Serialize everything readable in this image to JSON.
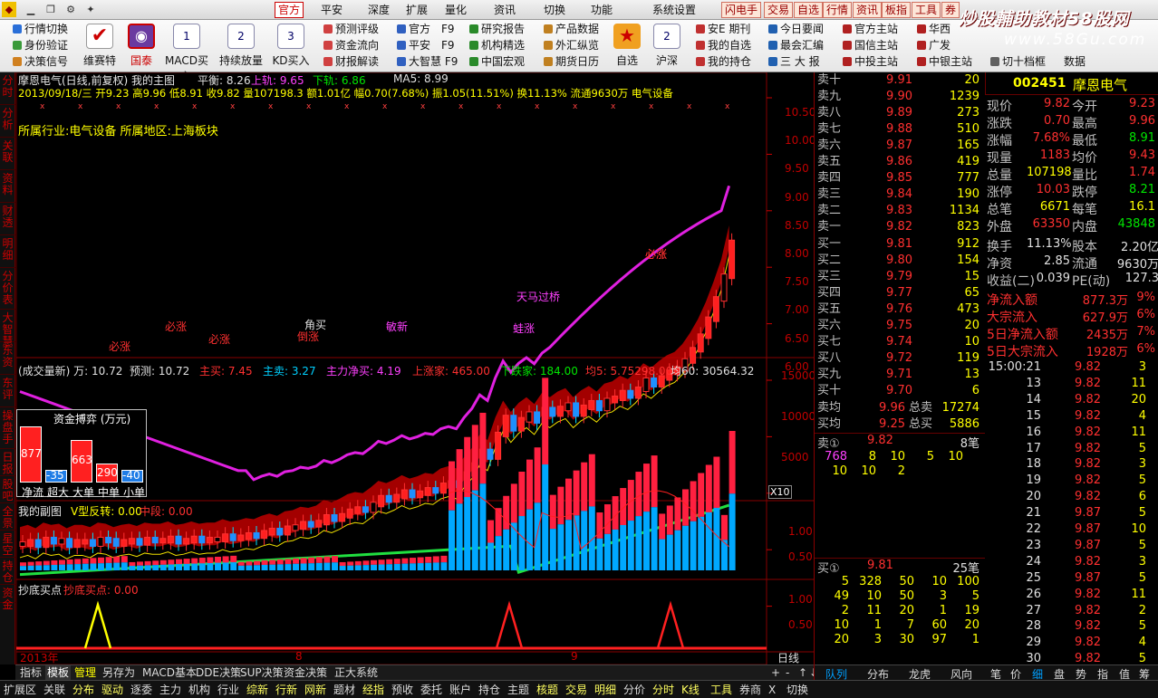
{
  "menubar": {
    "left_menus": [
      "官方",
      "平安",
      "深度",
      "扩展",
      "量化",
      "资讯",
      "切换",
      "功能",
      "系统设置"
    ],
    "quick": [
      "闪电手",
      "交易",
      "自选",
      "行情",
      "资讯",
      "板指",
      "工具",
      "券"
    ],
    "sys_icons": [
      "app-icon",
      "minimize-icon",
      "maximize-icon",
      "close-icon"
    ]
  },
  "brand": {
    "line1": "炒股輔助教材58股网",
    "line2": "www.58Gu.com"
  },
  "toolbar": {
    "col1": [
      "行情切换",
      "身份验证",
      "决策信号"
    ],
    "big": [
      "维赛特",
      "国泰",
      "MACD买入",
      "持续放量",
      "KD买入"
    ],
    "col2": [
      "预测评级",
      "资金流向",
      "财报解读"
    ],
    "col3": [
      "官方　F9",
      "平安　F9",
      "大智慧 F9"
    ],
    "col4": [
      "研究报告",
      "机构精选",
      "中国宏观"
    ],
    "col5": [
      "产品数据",
      "外汇纵览",
      "期货日历"
    ],
    "big2": [
      "自选",
      "沪深"
    ],
    "col6": [
      "安E 期刊",
      "我的自选",
      "我的持仓"
    ],
    "col7": [
      "今日要闻",
      "最会汇编",
      "三 大 报"
    ],
    "col8": [
      "官方主站",
      "国信主站",
      "中投主站"
    ],
    "col9": [
      "华西",
      "广发",
      "中银主站"
    ],
    "col10": [
      "切十档框",
      "数据"
    ]
  },
  "chart": {
    "title": "摩恩电气(日线,前复权) 我的主图",
    "pingheng": "平衡: 8.26",
    "shanggui": "上轨: 9.65",
    "xiagui": "下轨: 6.86",
    "ma5": "MA5: 8.99",
    "ohlc_line": "2013/09/18/三 开9.23 高9.96 低8.91 收9.82 量107198.3 额1.01亿 幅0.70(7.68%) 振1.05(11.51%) 换11.13% 流通9630万 电气设备",
    "industry": "所属行业:电气设备 所属地区:上海板块",
    "annotations": [
      "必涨",
      "必涨",
      "必涨",
      "倒涨",
      "角买",
      "敏新",
      "必涨",
      "天马过桥",
      "蛙涨",
      "必涨"
    ],
    "y_labels": [
      "10.50",
      "10.00",
      "9.50",
      "9.00",
      "8.50",
      "8.00",
      "7.50",
      "7.00",
      "6.50",
      "6.00"
    ],
    "vol_header": [
      "(成交量新) 万: 10.72",
      "预测: 10.72",
      "主买: 7.45",
      "主卖: 3.27",
      "主力净买: 4.19",
      "上涨家: 465.00",
      "下跌家: 184.00",
      "均5: 5.75298.00",
      "均60: 30564.32"
    ],
    "vol_y": [
      "15000",
      "10000",
      "5000"
    ],
    "fund_box": {
      "title": "资金搏弈 (万元)",
      "values": [
        "877",
        "-35",
        "663",
        "290",
        "-40"
      ],
      "labels": [
        "净流",
        "超大",
        "大单",
        "中单",
        "小单"
      ]
    },
    "x10": "X10",
    "sub1_header": [
      "我的副图",
      "V型反转: 0.00",
      "中段: 0.00"
    ],
    "sub1_y": [
      "1.00",
      "0.50"
    ],
    "sub2_header": [
      "抄底买点",
      "抄底买点: 0.00"
    ],
    "sub2_y": [
      "1.00",
      "0.50"
    ],
    "x_axis": [
      "2013年",
      "8",
      "9"
    ],
    "period": "日线"
  },
  "left_tabs": [
    "分时",
    "分析",
    "关联",
    "资料",
    "财透",
    "明细",
    "分价表",
    "大智慧",
    "东资",
    "东评",
    "操盘手",
    "日报",
    "股吧",
    "全景",
    "星空",
    "持仓",
    "资金"
  ],
  "tabs": [
    "指标",
    "模板",
    "管理",
    "另存为",
    "MACD基本",
    "DDE决策",
    "SUP决策",
    "资金决策",
    "正大系统"
  ],
  "quote": {
    "code": "002451",
    "name": "摩恩电气",
    "asks": [
      [
        "卖十",
        "9.91",
        "20"
      ],
      [
        "卖九",
        "9.90",
        "1239"
      ],
      [
        "卖八",
        "9.89",
        "273"
      ],
      [
        "卖七",
        "9.88",
        "510"
      ],
      [
        "卖六",
        "9.87",
        "165"
      ],
      [
        "卖五",
        "9.86",
        "419"
      ],
      [
        "卖四",
        "9.85",
        "777"
      ],
      [
        "卖三",
        "9.84",
        "190"
      ],
      [
        "卖二",
        "9.83",
        "1134"
      ],
      [
        "卖一",
        "9.82",
        "823"
      ]
    ],
    "bids": [
      [
        "买一",
        "9.81",
        "912"
      ],
      [
        "买二",
        "9.80",
        "154"
      ],
      [
        "买三",
        "9.79",
        "15"
      ],
      [
        "买四",
        "9.77",
        "65"
      ],
      [
        "买五",
        "9.76",
        "473"
      ],
      [
        "买六",
        "9.75",
        "20"
      ],
      [
        "买七",
        "9.74",
        "10"
      ],
      [
        "买八",
        "9.72",
        "119"
      ],
      [
        "买九",
        "9.71",
        "13"
      ],
      [
        "买十",
        "9.70",
        "6"
      ]
    ],
    "avg": [
      [
        "卖均",
        "9.96",
        "总卖",
        "17274"
      ],
      [
        "买均",
        "9.25",
        "总买",
        "5886"
      ]
    ],
    "sell1": {
      "label": "卖①",
      "price": "9.82",
      "count": "8笔",
      "queue": [
        "768",
        "8",
        "10",
        "5",
        "10",
        "10",
        "10",
        "2"
      ]
    },
    "buy1": {
      "label": "买①",
      "price": "9.81",
      "count": "25笔",
      "queue": [
        "5",
        "328",
        "50",
        "10",
        "100",
        "49",
        "10",
        "50",
        "3",
        "5",
        "2",
        "11",
        "20",
        "1",
        "19",
        "10",
        "1",
        "7",
        "60",
        "20",
        "20",
        "3",
        "30",
        "97",
        "1"
      ]
    },
    "stats": [
      [
        "现价",
        "9.82",
        "今开",
        "9.23"
      ],
      [
        "涨跌",
        "0.70",
        "最高",
        "9.96"
      ],
      [
        "涨幅",
        "7.68%",
        "最低",
        "8.91"
      ],
      [
        "现量",
        "1183",
        "均价",
        "9.43"
      ],
      [
        "总量",
        "107198",
        "量比",
        "1.74"
      ],
      [
        "涨停",
        "10.03",
        "跌停",
        "8.21"
      ],
      [
        "总笔",
        "6671",
        "每笔",
        "16.1"
      ],
      [
        "外盘",
        "63350",
        "内盘",
        "43848"
      ]
    ],
    "stats2": [
      [
        "换手",
        "11.13%",
        "股本",
        "2.20亿"
      ],
      [
        "净资",
        "2.85",
        "流通",
        "9630万"
      ],
      [
        "收益(二)",
        "0.039",
        "PE(动)",
        "127.3"
      ]
    ],
    "flows": [
      [
        "净流入额",
        "877.3万",
        "9%"
      ],
      [
        "大宗流入",
        "627.9万",
        "6%"
      ],
      [
        "5日净流入额",
        "2435万",
        "7%"
      ],
      [
        "5日大宗流入",
        "1928万",
        "6%"
      ]
    ],
    "ticks": [
      [
        "15:00:21",
        "9.82",
        "3"
      ],
      [
        "13",
        "9.82",
        "11"
      ],
      [
        "14",
        "9.82",
        "20"
      ],
      [
        "15",
        "9.82",
        "4"
      ],
      [
        "16",
        "9.82",
        "11"
      ],
      [
        "17",
        "9.82",
        "5"
      ],
      [
        "18",
        "9.82",
        "3"
      ],
      [
        "19",
        "9.82",
        "5"
      ],
      [
        "20",
        "9.82",
        "6"
      ],
      [
        "21",
        "9.87",
        "5"
      ],
      [
        "22",
        "9.87",
        "10"
      ],
      [
        "23",
        "9.87",
        "5"
      ],
      [
        "24",
        "9.82",
        "3"
      ],
      [
        "25",
        "9.87",
        "5"
      ],
      [
        "26",
        "9.82",
        "11"
      ],
      [
        "27",
        "9.82",
        "2"
      ],
      [
        "28",
        "9.82",
        "5"
      ],
      [
        "29",
        "9.82",
        "4"
      ],
      [
        "30",
        "9.82",
        "5"
      ]
    ]
  },
  "rtabs": [
    "队列",
    "分布",
    "龙虎",
    "风向"
  ],
  "rtabs2": [
    "笔",
    "价",
    "细",
    "盘",
    "势",
    "指",
    "值",
    "筹"
  ],
  "bottom": [
    "扩展区",
    "关联",
    "分布",
    "驱动",
    "逐委",
    "主力",
    "机构",
    "行业",
    "综新",
    "行新",
    "网新",
    "题材",
    "经指",
    "预收",
    "委托",
    "账户",
    "持仓",
    "主题",
    "核题",
    "交易",
    "明细",
    "分价",
    "分时",
    "K线",
    "工具",
    "券商",
    "X",
    "切换"
  ]
}
